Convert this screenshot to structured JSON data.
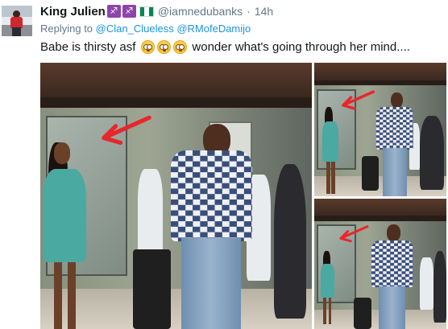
{
  "tweet": {
    "display_name": "King Julien",
    "name_emojis": [
      "♐",
      "♐"
    ],
    "handle": "@iamnedubanks",
    "separator": "·",
    "time": "14h",
    "reply_prefix": "Replying to",
    "reply_to": [
      "@Clan_Clueless",
      "@RMofeDamijo"
    ],
    "text_before_emoji": "Babe is thirsty asf",
    "text_after_emoji": "wonder what's going through her mind....",
    "emoji_count": 3,
    "emoji_name": "flushed-face-icon"
  },
  "media": {
    "photo_count": 3,
    "arrow_color": "#e8262c"
  },
  "colors": {
    "text": "#14171a",
    "secondary": "#657786",
    "link": "#1b95e0"
  }
}
